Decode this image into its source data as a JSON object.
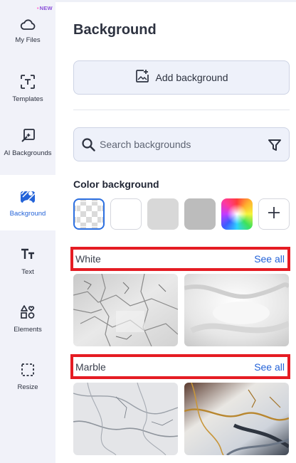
{
  "sidebar": {
    "new_badge": "NEW",
    "items": [
      {
        "label": "My Files",
        "icon": "cloud-icon"
      },
      {
        "label": "Templates",
        "icon": "templates-icon"
      },
      {
        "label": "AI Backgrounds",
        "icon": "ai-backgrounds-icon"
      },
      {
        "label": "Background",
        "icon": "background-icon",
        "active": true
      },
      {
        "label": "Text",
        "icon": "text-icon"
      },
      {
        "label": "Elements",
        "icon": "elements-icon"
      },
      {
        "label": "Resize",
        "icon": "resize-icon"
      }
    ]
  },
  "panel": {
    "title": "Background",
    "add_background_label": "Add background",
    "search_placeholder": "Search backgrounds",
    "color_section_title": "Color background",
    "color_swatches": [
      {
        "name": "transparent",
        "color": "transparent",
        "selected": true
      },
      {
        "name": "white",
        "color": "#ffffff"
      },
      {
        "name": "light-gray",
        "color": "#d8d8d8"
      },
      {
        "name": "gray",
        "color": "#bcbcbc"
      },
      {
        "name": "color-picker",
        "color": "rainbow"
      },
      {
        "name": "add-color",
        "color": "plus-icon"
      }
    ],
    "categories": [
      {
        "name": "White",
        "see_all": "See all"
      },
      {
        "name": "Marble",
        "see_all": "See all"
      }
    ]
  },
  "colors": {
    "accent": "#2463d8",
    "highlight_border": "#e51c23",
    "sidebar_bg": "#f1f2f9",
    "new_badge": "#8a4fd8"
  }
}
